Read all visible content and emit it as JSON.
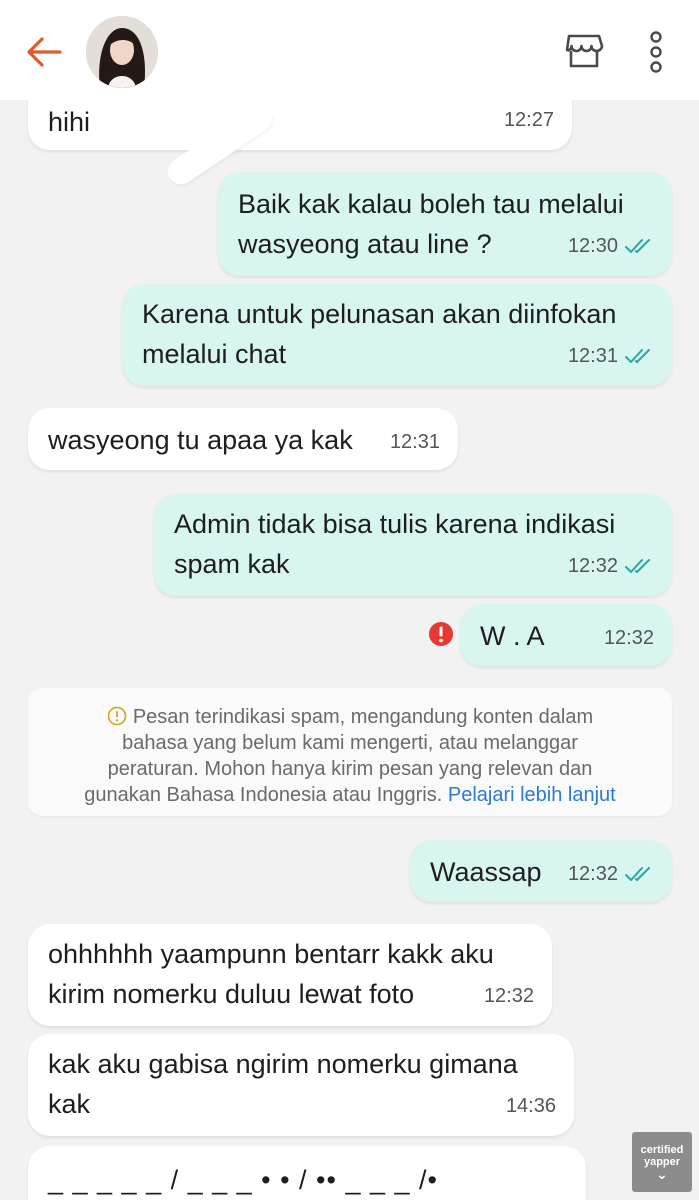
{
  "header": {
    "back_icon": "arrow-left-icon",
    "shop_icon": "shop-icon",
    "more_icon": "more-vertical-icon",
    "accent_color": "#e2582f"
  },
  "messages": [
    {
      "side": "in",
      "lines": [
        "hihi"
      ],
      "time": "12:27"
    },
    {
      "side": "out",
      "lines": [
        "Baik kak kalau boleh tau melalui",
        "wasyeong atau line ?"
      ],
      "time": "12:30",
      "status": "read"
    },
    {
      "side": "out",
      "lines": [
        "Karena untuk pelunasan akan diinfokan",
        "melalui chat"
      ],
      "time": "12:31",
      "status": "read"
    },
    {
      "side": "in",
      "lines": [
        "wasyeong tu apaa ya kak"
      ],
      "time": "12:31"
    },
    {
      "side": "out",
      "lines": [
        "Admin tidak bisa tulis karena indikasi",
        "spam kak"
      ],
      "time": "12:32",
      "status": "read"
    },
    {
      "side": "out",
      "lines": [
        "W . A"
      ],
      "time": "12:32",
      "status": "failed"
    },
    {
      "side": "out",
      "lines": [
        "Waassap"
      ],
      "time": "12:32",
      "status": "read"
    },
    {
      "side": "in",
      "lines": [
        "ohhhhhh yaampunn bentarr kakk aku",
        "kirim nomerku duluu lewat foto"
      ],
      "time": "12:32"
    },
    {
      "side": "in",
      "lines": [
        "kak aku gabisa ngirim nomerku gimana",
        "kak"
      ],
      "time": "14:36"
    },
    {
      "side": "in",
      "lines": [
        "_ _ _ _ _ / _ _ _ • • / •• _ _ _ /•"
      ],
      "time": ""
    }
  ],
  "notice": {
    "lines": [
      "Pesan terindikasi spam, mengandung konten dalam",
      "bahasa yang belum kami mengerti, atau melanggar",
      "peraturan. Mohon hanya kirim pesan yang relevan dan",
      "gunakan Bahasa Indonesia atau Inggris."
    ],
    "link": "Pelajari lebih lanjut"
  },
  "watermark": {
    "line1": "certified",
    "line2": "yapper"
  },
  "colors": {
    "incoming_bubble": "#ffffff",
    "outgoing_bubble": "#d9f5f0",
    "read_tick": "#2aa6a0",
    "error": "#e53935",
    "link": "#2a7bd4"
  }
}
